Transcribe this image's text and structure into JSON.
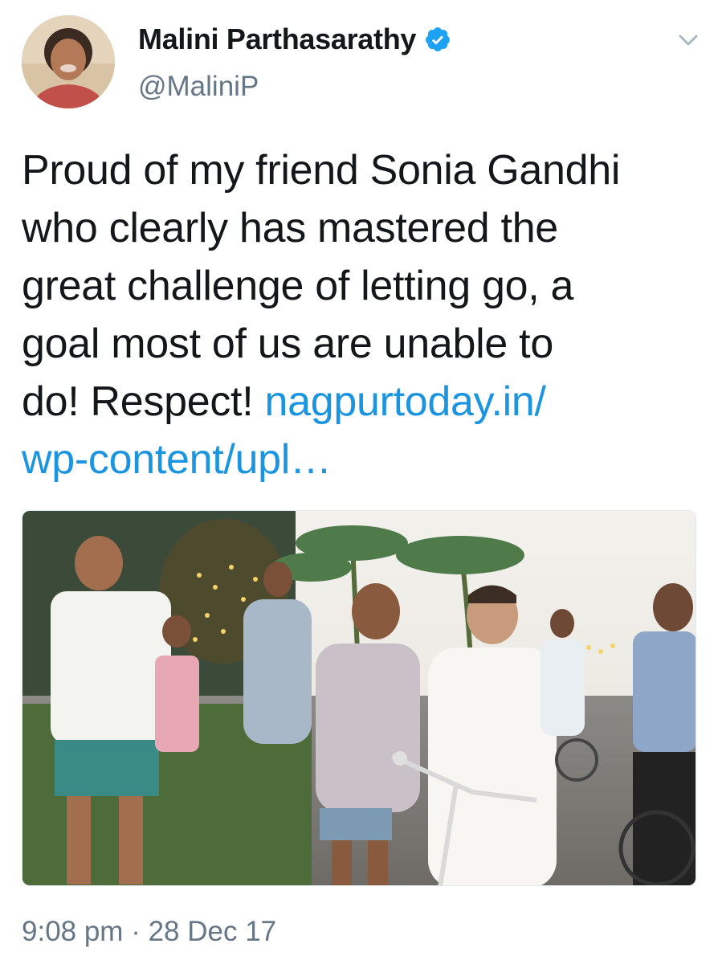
{
  "author": {
    "display_name": "Malini Parthasarathy",
    "handle": "@MaliniP",
    "verified": true,
    "avatar_icon": "profile-photo"
  },
  "tweet": {
    "text_lines": [
      "Proud of my friend Sonia Gandhi",
      "who clearly has mastered the",
      "great challenge of letting go, a",
      "goal most of us are unable to",
      "do! Respect! "
    ],
    "link_line_1": "nagpurtoday.in/",
    "link_line_2": "wp-content/upl…",
    "timestamp": "9:08 pm · 28 Dec 17"
  },
  "colors": {
    "link": "#1b95e0",
    "verified_badge": "#1da1f2",
    "secondary_text": "#657786"
  },
  "icons": {
    "verified": "verified-badge-icon",
    "menu": "chevron-down-icon"
  }
}
